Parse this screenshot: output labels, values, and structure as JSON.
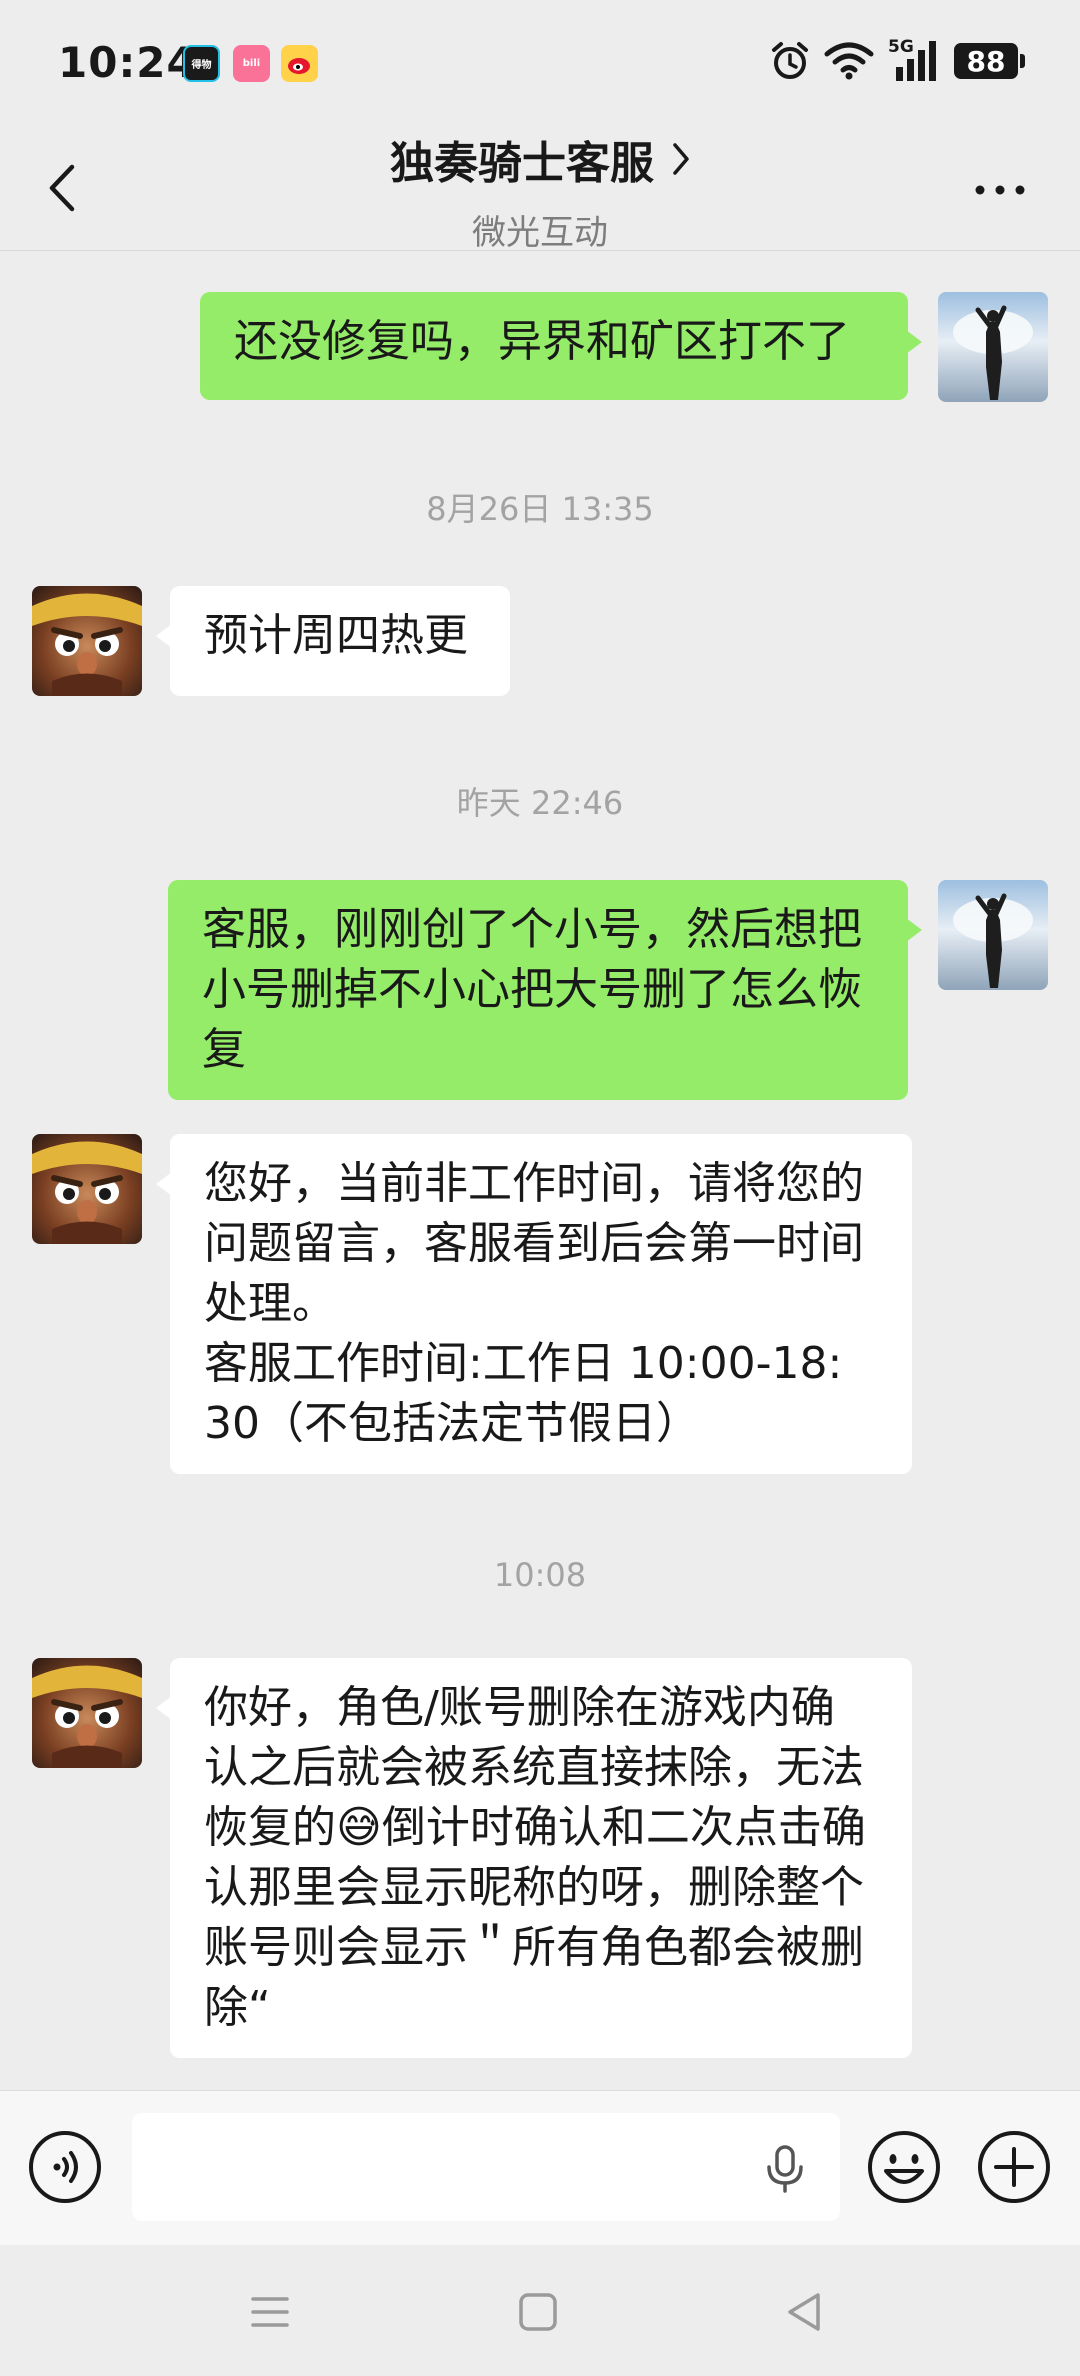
{
  "status_bar": {
    "time": "10:24",
    "apps": [
      {
        "name": "app-notification-icon",
        "label": "得物"
      },
      {
        "name": "bilibili-icon",
        "label": "bili"
      },
      {
        "name": "weibo-icon",
        "label": "微"
      }
    ],
    "network": "5G",
    "battery": "88"
  },
  "header": {
    "title": "独奏骑士客服",
    "subtitle": "微光互动"
  },
  "messages": [
    {
      "from": "me",
      "text": "还没修复吗，异界和矿区打不了"
    },
    {
      "time": "8月26日 13:35"
    },
    {
      "from": "them",
      "text": "预计周四热更"
    },
    {
      "time": "昨天 22:46"
    },
    {
      "from": "me",
      "text": "客服，刚刚创了个小号，然后想把\n小号删掉不小心把大号删了怎么恢\n复"
    },
    {
      "from": "them",
      "text": "您好，当前非工作时间，请将您的\n问题留言，客服看到后会第一时间\n处理。\n客服工作时间:工作日 10:00-18:\n30（不包括法定节假日）"
    },
    {
      "time": "10:08"
    },
    {
      "from": "them",
      "text": "你好，角色/账号删除在游戏内确\n认之后就会被系统直接抹除，无法\n恢复的😅倒计时确认和二次点击确\n认那里会显示昵称的呀，删除整个\n账号则会显示＂所有角色都会被删\n除“"
    }
  ],
  "input": {
    "value": "",
    "placeholder": ""
  },
  "colors": {
    "my_bubble": "#95ec69",
    "their_bubble": "#ffffff",
    "background": "#ededed"
  }
}
